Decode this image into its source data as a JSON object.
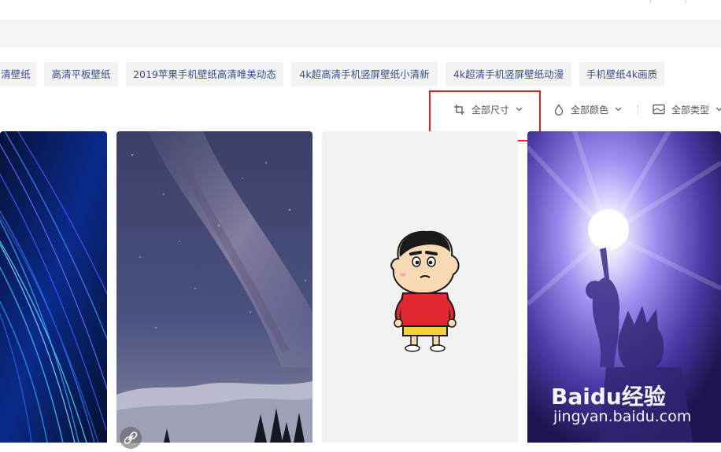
{
  "tags": [
    {
      "label": "清壁纸"
    },
    {
      "label": "高清平板壁纸"
    },
    {
      "label": "2019苹果手机壁纸高清唯美动态"
    },
    {
      "label": "4k超高清手机竖屏壁纸小清新"
    },
    {
      "label": "4k超清手机竖屏壁纸动漫"
    },
    {
      "label": "手机壁纸4k画质"
    }
  ],
  "filters": {
    "size": {
      "label": "全部尺寸",
      "icon": "crop-icon"
    },
    "color": {
      "label": "全部颜色",
      "icon": "droplet-icon"
    },
    "type": {
      "label": "全部类型",
      "icon": "image-frame-icon"
    }
  },
  "images": [
    {
      "name": "blue-fiber-light-wallpaper"
    },
    {
      "name": "milky-way-night-sky-wallpaper"
    },
    {
      "name": "crayon-shinchan-wallpaper"
    },
    {
      "name": "purple-anime-energy-wallpaper"
    }
  ],
  "watermark": {
    "brand": "Baidu经验",
    "url": "jingyan.baidu.com"
  },
  "colors": {
    "tag_text": "#3b4b8c",
    "tag_bg": "#f4f4f4",
    "highlight_box": "#e02424"
  }
}
